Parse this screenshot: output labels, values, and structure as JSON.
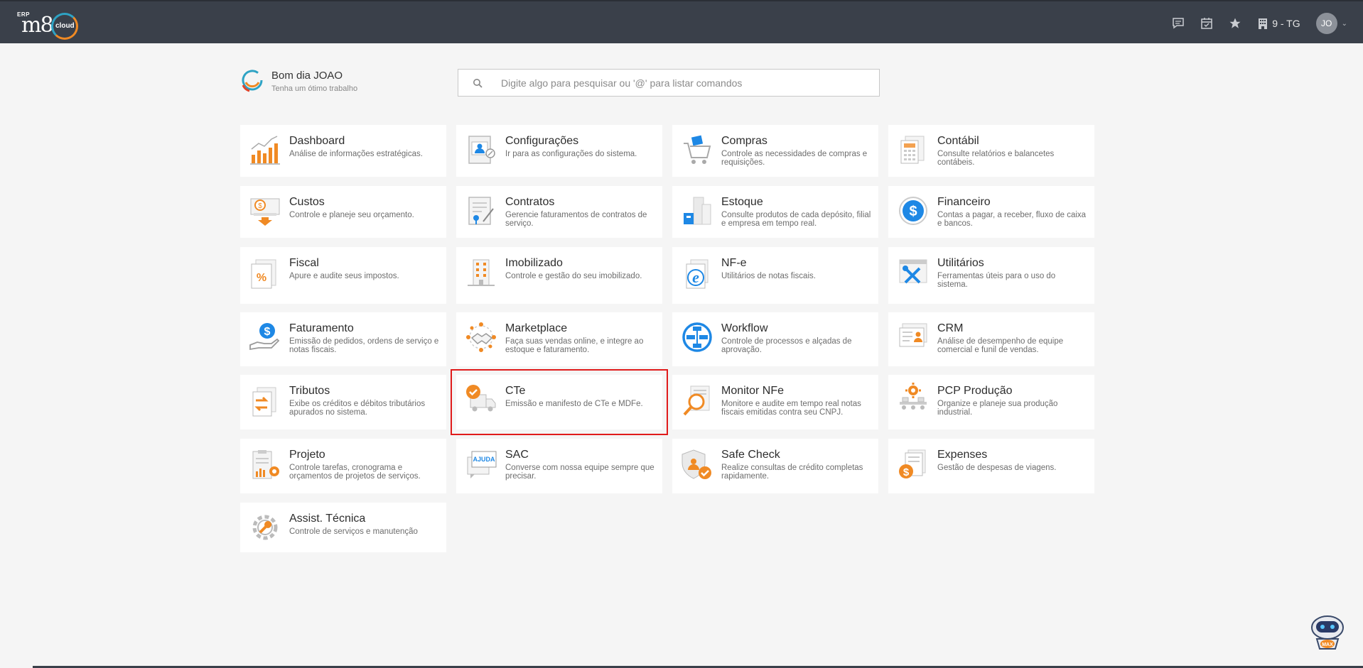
{
  "topbar": {
    "logo": {
      "erp": "ERP",
      "brand": "m8",
      "cloud": "cloud"
    },
    "company": "9 - TG",
    "avatar_initials": "JO",
    "icons": [
      "chat-icon",
      "calendar-check-icon",
      "star-icon",
      "building-icon"
    ]
  },
  "greeting": {
    "title": "Bom dia JOAO",
    "subtitle": "Tenha um ótimo trabalho"
  },
  "search": {
    "placeholder": "Digite algo para pesquisar ou '@' para listar comandos"
  },
  "modules": [
    {
      "title": "Dashboard",
      "desc": "Análise de informações estratégicas."
    },
    {
      "title": "Configurações",
      "desc": "Ir para as configurações do sistema."
    },
    {
      "title": "Compras",
      "desc": "Controle as necessidades de compras e requisições."
    },
    {
      "title": "Contábil",
      "desc": "Consulte relatórios e balancetes contábeis."
    },
    {
      "title": "Custos",
      "desc": "Controle e planeje seu orçamento."
    },
    {
      "title": "Contratos",
      "desc": "Gerencie faturamentos de contratos de serviço."
    },
    {
      "title": "Estoque",
      "desc": "Consulte produtos de cada depósito, filial e empresa em tempo real."
    },
    {
      "title": "Financeiro",
      "desc": "Contas a pagar, a receber, fluxo de caixa e bancos."
    },
    {
      "title": "Fiscal",
      "desc": "Apure e audite seus impostos."
    },
    {
      "title": "Imobilizado",
      "desc": "Controle e gestão do seu imobilizado."
    },
    {
      "title": "NF-e",
      "desc": "Utilitários de notas fiscais."
    },
    {
      "title": "Utilitários",
      "desc": "Ferramentas úteis para o uso do sistema."
    },
    {
      "title": "Faturamento",
      "desc": "Emissão de pedidos, ordens de serviço e notas fiscais."
    },
    {
      "title": "Marketplace",
      "desc": "Faça suas vendas online, e integre ao estoque e faturamento."
    },
    {
      "title": "Workflow",
      "desc": "Controle de processos e alçadas de aprovação."
    },
    {
      "title": "CRM",
      "desc": "Análise de desempenho de equipe comercial e funil de vendas."
    },
    {
      "title": "Tributos",
      "desc": "Exibe os créditos e débitos tributários apurados no sistema."
    },
    {
      "title": "CTe",
      "desc": "Emissão e manifesto de CTe e MDFe."
    },
    {
      "title": "Monitor NFe",
      "desc": "Monitore e audite em tempo real notas fiscais emitidas contra seu CNPJ."
    },
    {
      "title": "PCP Produção",
      "desc": "Organize e planeje sua produção industrial."
    },
    {
      "title": "Projeto",
      "desc": "Controle tarefas, cronograma e orçamentos de projetos de serviços."
    },
    {
      "title": "SAC",
      "desc": "Converse com nossa equipe sempre que precisar."
    },
    {
      "title": "Safe Check",
      "desc": "Realize consultas de crédito completas rapidamente."
    },
    {
      "title": "Expenses",
      "desc": "Gestão de despesas de viagens."
    },
    {
      "title": "Assist. Técnica",
      "desc": "Controle de serviços e manutenção"
    }
  ],
  "sac_badge": "AJUDA",
  "assistant_badge": "MAX",
  "colors": {
    "topbar": "#3a404a",
    "accent_orange": "#f08a24",
    "accent_blue": "#1e88e5",
    "selection": "#e01b1b"
  }
}
